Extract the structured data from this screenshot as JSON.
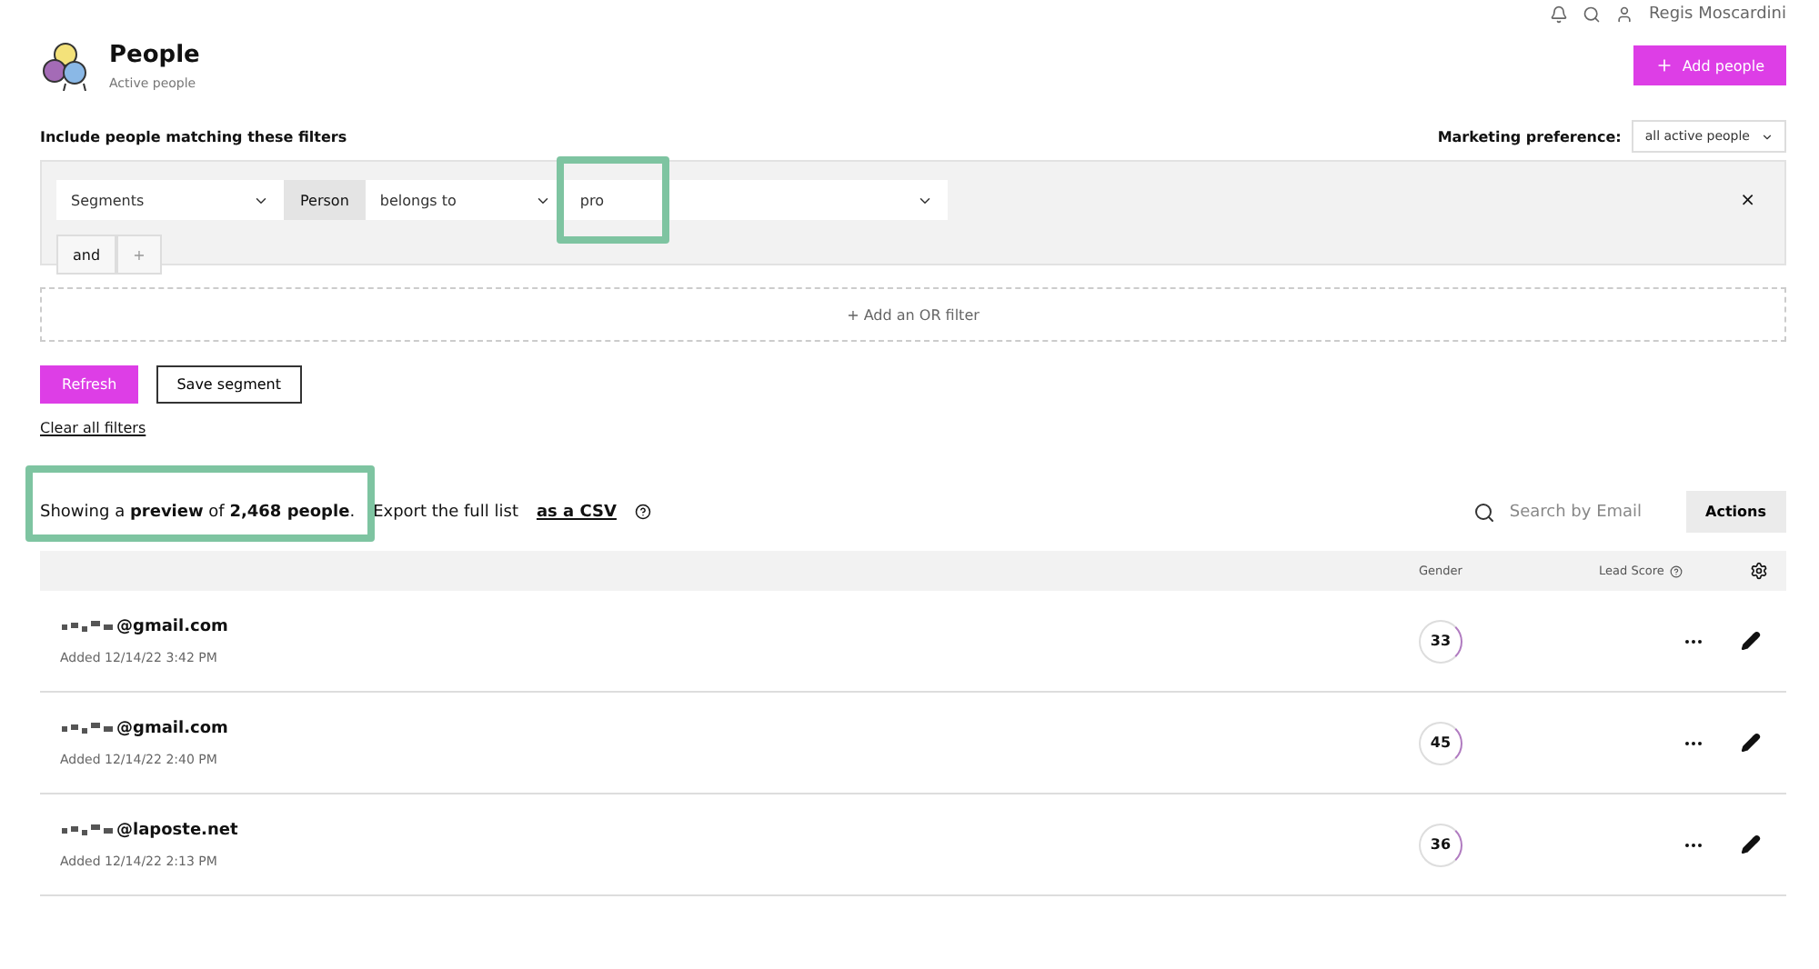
{
  "topbar": {
    "user": "Regis Moscardini"
  },
  "header": {
    "title": "People",
    "subtitle": "Active people",
    "add_button": "Add people"
  },
  "filters": {
    "heading": "Include people matching these filters",
    "marketing_label": "Marketing preference:",
    "marketing_value": "all active people",
    "rule": {
      "field": "Segments",
      "entity": "Person",
      "operator": "belongs to",
      "value": "pro"
    },
    "and_button": "and",
    "plus_button": "+",
    "remove": "×",
    "or_plus": "+",
    "or_filter": "Add an OR filter",
    "refresh": "Refresh",
    "save": "Save segment",
    "clear": "Clear all filters"
  },
  "summary": {
    "text": "Showing a **preview** of **2,468 people**.",
    "export": "Export the full list",
    "link": "as a CSV",
    "search_placeholder": "Search by Email",
    "actions": "Actions"
  },
  "table": {
    "columns": [
      "Gender",
      "Lead Score"
    ],
    "rows": [
      {
        "email": "@gmail.com",
        "added": "Added 12/14/22 3:42 PM",
        "score": "33"
      },
      {
        "email": "@gmail.com",
        "added": "Added 12/14/22 2:40 PM",
        "score": "45"
      },
      {
        "email": "@laposte.net",
        "added": "Added 12/14/22 2:13 PM",
        "score": "36"
      }
    ]
  }
}
